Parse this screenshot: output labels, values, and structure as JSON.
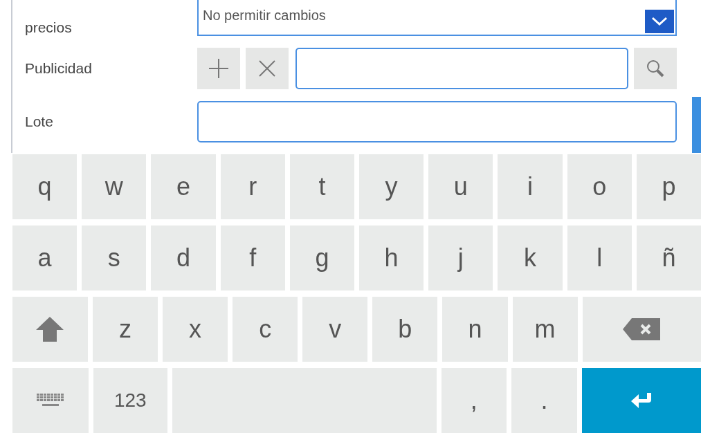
{
  "form": {
    "price_change": {
      "label": "precios",
      "value": "No permitir cambios"
    },
    "advertising": {
      "label": "Publicidad"
    },
    "batch": {
      "label": "Lote"
    }
  },
  "keyboard": {
    "rows": [
      [
        {
          "kind": "char",
          "label": "q"
        },
        {
          "kind": "char",
          "label": "w"
        },
        {
          "kind": "char",
          "label": "e"
        },
        {
          "kind": "char",
          "label": "r"
        },
        {
          "kind": "char",
          "label": "t"
        },
        {
          "kind": "char",
          "label": "y"
        },
        {
          "kind": "char",
          "label": "u"
        },
        {
          "kind": "char",
          "label": "i"
        },
        {
          "kind": "char",
          "label": "o"
        },
        {
          "kind": "char",
          "label": "p"
        }
      ],
      [
        {
          "kind": "char",
          "label": "a"
        },
        {
          "kind": "char",
          "label": "s"
        },
        {
          "kind": "char",
          "label": "d"
        },
        {
          "kind": "char",
          "label": "f"
        },
        {
          "kind": "char",
          "label": "g"
        },
        {
          "kind": "char",
          "label": "h"
        },
        {
          "kind": "char",
          "label": "j"
        },
        {
          "kind": "char",
          "label": "k"
        },
        {
          "kind": "char",
          "label": "l"
        },
        {
          "kind": "char",
          "label": "ñ"
        }
      ],
      [
        {
          "kind": "shift"
        },
        {
          "kind": "char",
          "label": "z"
        },
        {
          "kind": "char",
          "label": "x"
        },
        {
          "kind": "char",
          "label": "c"
        },
        {
          "kind": "char",
          "label": "v"
        },
        {
          "kind": "char",
          "label": "b"
        },
        {
          "kind": "char",
          "label": "n"
        },
        {
          "kind": "char",
          "label": "m"
        },
        {
          "kind": "backspace"
        }
      ],
      [
        {
          "kind": "layout"
        },
        {
          "kind": "mode",
          "label": "123"
        },
        {
          "kind": "space"
        },
        {
          "kind": "char",
          "label": ","
        },
        {
          "kind": "char",
          "label": "."
        },
        {
          "kind": "enter"
        }
      ]
    ]
  }
}
